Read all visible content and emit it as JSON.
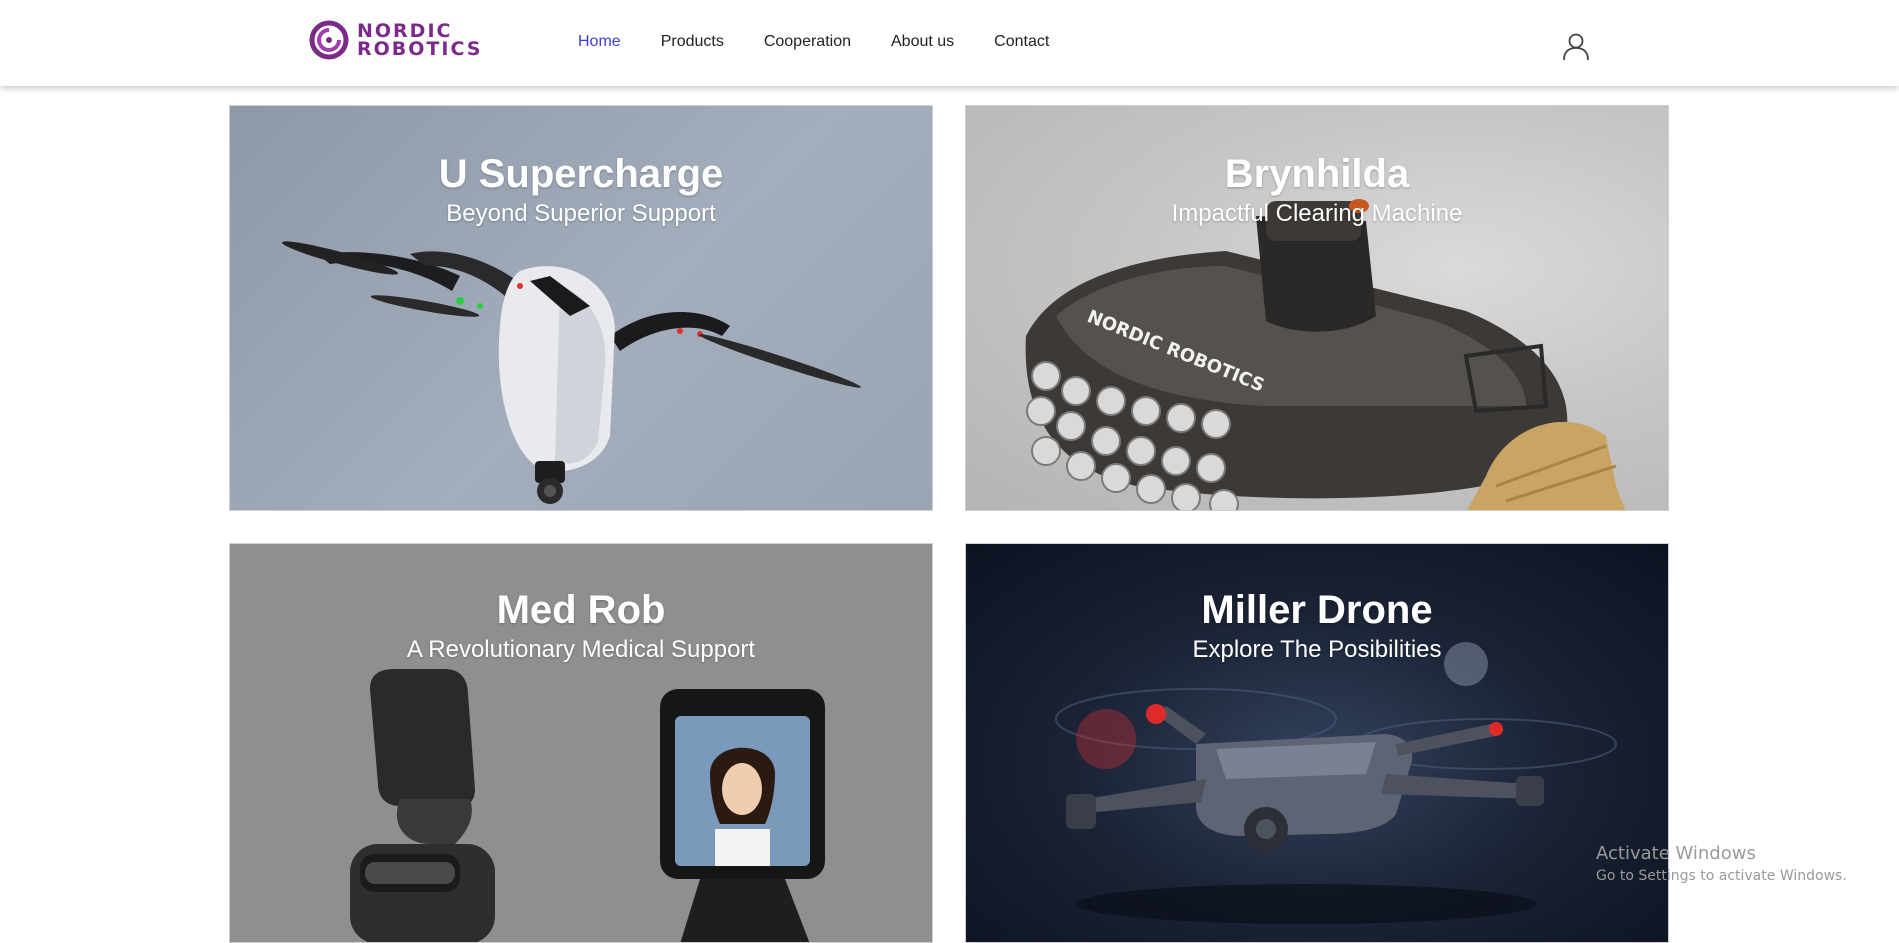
{
  "header": {
    "logo": {
      "line1": "NORDIC",
      "line2": "ROBOTICS"
    },
    "nav": [
      {
        "label": "Home",
        "active": true
      },
      {
        "label": "Products",
        "active": false
      },
      {
        "label": "Cooperation",
        "active": false
      },
      {
        "label": "About us",
        "active": false
      },
      {
        "label": "Contact",
        "active": false
      }
    ],
    "user_icon": "user-icon",
    "active_color": "#3b3fd8",
    "brand_color": "#7b2a8a"
  },
  "products": [
    {
      "title": "U Supercharge",
      "subtitle": "Beyond Superior Support",
      "image": "drone-with-wings"
    },
    {
      "title": "Brynhilda",
      "subtitle": "Impactful Clearing Machine",
      "image": "tracked-clearing-robot",
      "image_text": "NORDIC ROBOTICS"
    },
    {
      "title": "Med Rob",
      "subtitle": "A Revolutionary Medical Support",
      "image": "telepresence-robots"
    },
    {
      "title": "Miller Drone",
      "subtitle": "Explore The Posibilities",
      "image": "quadcopter-drone"
    }
  ],
  "watermark": {
    "title": "Activate Windows",
    "subtitle": "Go to Settings to activate Windows."
  }
}
